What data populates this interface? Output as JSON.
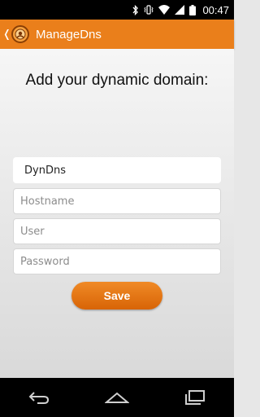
{
  "status_bar": {
    "time": "00:47",
    "icons": [
      "bluetooth-icon",
      "vibrate-icon",
      "wifi-icon",
      "signal-icon",
      "battery-icon"
    ]
  },
  "action_bar": {
    "back_glyph": "❬",
    "app_icon": "app-logo-icon",
    "title": "ManageDns",
    "color": "#ea7f1b"
  },
  "form": {
    "heading": "Add your dynamic domain:",
    "service": {
      "value": "DynDns"
    },
    "hostname": {
      "placeholder": "Hostname"
    },
    "user": {
      "placeholder": "User"
    },
    "password": {
      "placeholder": "Password"
    },
    "save_label": "Save",
    "button_color": "#e4741a"
  },
  "nav_bar": {
    "buttons": [
      "back-icon",
      "home-icon",
      "recent-apps-icon"
    ]
  }
}
